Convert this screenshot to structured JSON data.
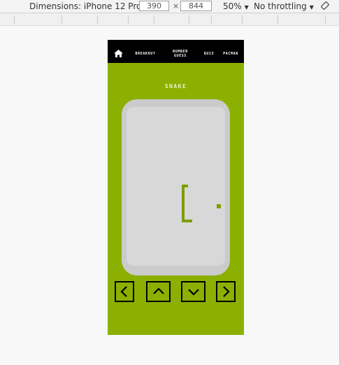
{
  "devtools": {
    "dimensions_label": "Dimensions: iPhone 12 Pro",
    "width": "390",
    "height": "844",
    "times": "×",
    "zoom": "50%",
    "throttling": "No throttling"
  },
  "nav": {
    "home_icon": "home-icon",
    "links": [
      "BREAKOUT",
      "NUMBER GUESS",
      "QUIZ",
      "PACMAN"
    ]
  },
  "game": {
    "title": "SNAKE",
    "controls": [
      "left-arrow",
      "up-arrow",
      "down-arrow",
      "right-arrow"
    ]
  },
  "colors": {
    "background": "#8bb000",
    "snake": "#7e9d00",
    "board": "#d8d8d8",
    "nav": "#000000"
  }
}
